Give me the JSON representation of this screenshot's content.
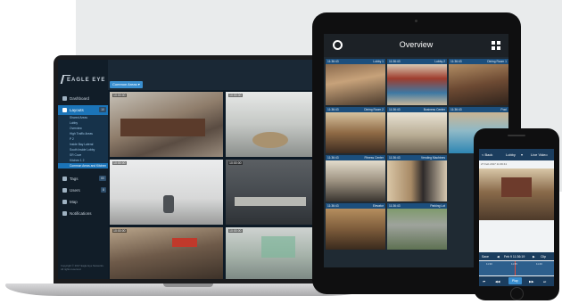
{
  "laptop": {
    "brand": "EAGLE EYE",
    "layout_button": "Common Areas",
    "nav": [
      {
        "label": "Dashboard"
      },
      {
        "label": "Layouts",
        "count": "10"
      },
      {
        "label": "Tags",
        "count": "60"
      },
      {
        "label": "Users",
        "count": "8"
      },
      {
        "label": "Map"
      },
      {
        "label": "Notifications"
      }
    ],
    "layout_items": [
      "Shared Areas",
      "Lobby",
      "Overview",
      "High Traffic Areas",
      "P 2",
      "Inside Bay Lateral",
      "South Inside Lobby",
      "SR Cove",
      "Kitchen 1 2",
      "Common Areas and Kitchen"
    ],
    "copyright": "Copyright © 2017 Eagle Eye Networks. All rights reserved.",
    "cameras": [
      {
        "time": "10:00:00"
      },
      {
        "time": "10:00:00"
      },
      {
        "time": "10:00:00"
      },
      {
        "time": "10:00:00"
      },
      {
        "time": "10:00:00"
      },
      {
        "time": "10:00:00"
      }
    ]
  },
  "tablet": {
    "title": "Overview",
    "tiles": [
      {
        "time": "11:36:43",
        "name": "Lobby 1"
      },
      {
        "time": "11:36:43",
        "name": "Lobby 2"
      },
      {
        "time": "11:36:43",
        "name": "Dining Room 1"
      },
      {
        "time": "11:36:43",
        "name": "Dining Room 2"
      },
      {
        "time": "11:36:43",
        "name": "Business Center"
      },
      {
        "time": "11:36:43",
        "name": "Pool"
      },
      {
        "time": "11:36:43",
        "name": "Fitness Center"
      },
      {
        "time": "11:36:43",
        "name": "Vending Machines"
      },
      {
        "time": "11:36:43",
        "name": "Elevator"
      },
      {
        "time": "11:36:43",
        "name": "Parking Lot"
      }
    ]
  },
  "phone": {
    "back": "< Back",
    "title": "Lobby",
    "mode": "Live Video",
    "date": "27 Feb 2017 11:36:41",
    "ctrl_left": "Save",
    "ctrl_mid": "Feb 9 11:36:19",
    "ctrl_right": "Clip",
    "times": [
      "11:30",
      "11:35",
      "11:40"
    ],
    "play": "Play"
  },
  "colors": {
    "accent": "#1b74b8",
    "tablet_bar": "#1c4f7d",
    "phone_bar": "#1b3d5e"
  }
}
